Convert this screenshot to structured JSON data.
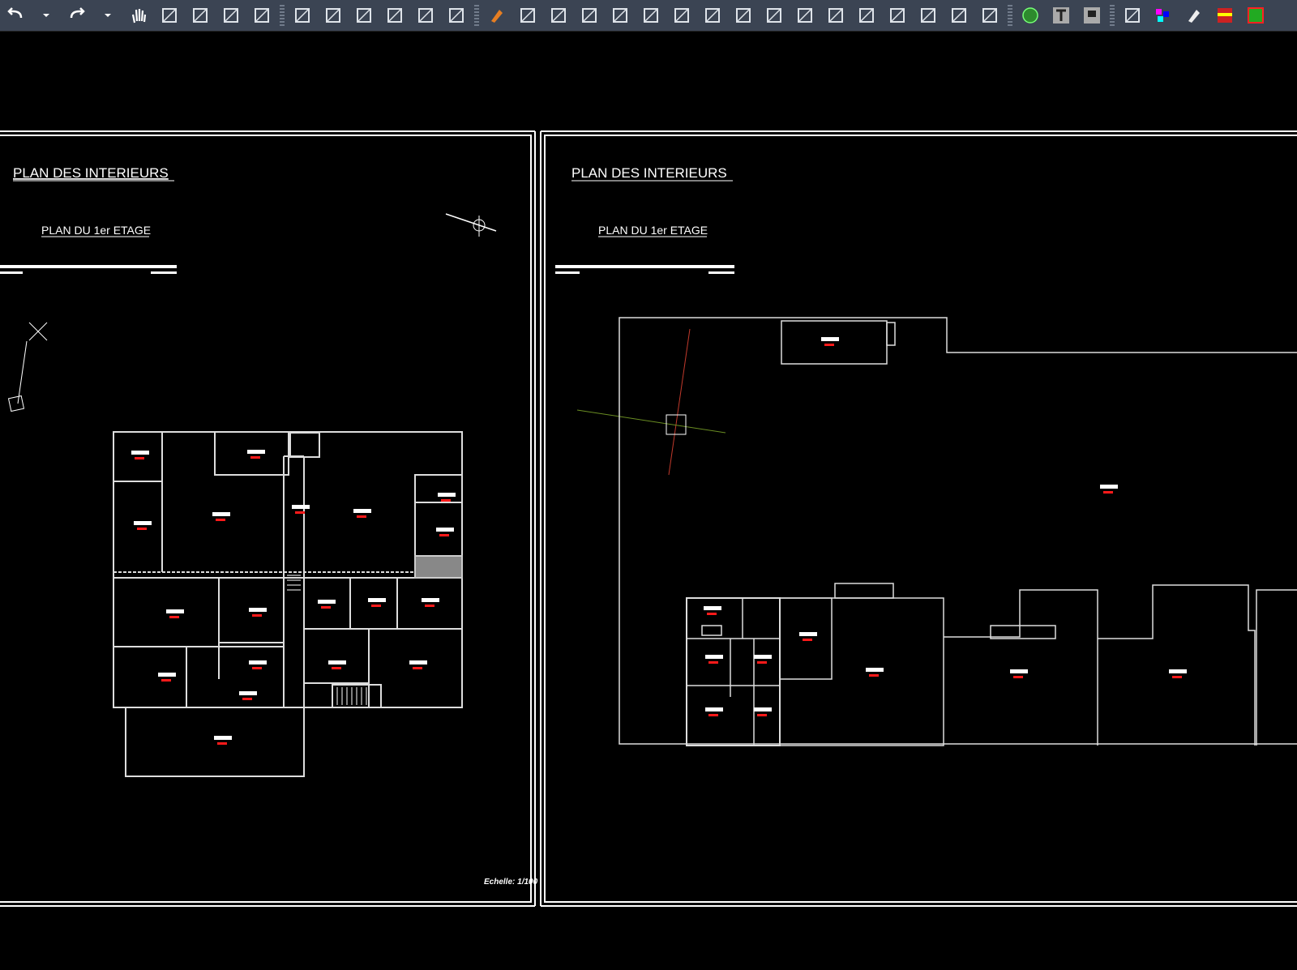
{
  "toolbar": {
    "groups": [
      [
        "undo-icon",
        "undo-dropdown-icon",
        "redo-icon",
        "redo-dropdown-icon",
        "pan-hand-icon",
        "zoom-realtime-icon",
        "zoom-window-icon",
        "zoom-extents-icon",
        "zoom-previous-icon"
      ],
      [
        "properties-icon",
        "design-center-icon",
        "tool-palettes-icon",
        "sheet-set-icon",
        "markup-icon",
        "quickcalc-icon"
      ],
      [
        "erase-icon",
        "copy-icon",
        "mirror-icon",
        "offset-icon",
        "move-icon",
        "rotate-icon",
        "scale-icon",
        "stretch-icon",
        "trim-icon",
        "extend-icon",
        "break-icon",
        "break-at-point-icon",
        "join-icon",
        "chamfer-icon",
        "fillet-icon",
        "spline-icon",
        "solid-3d-icon"
      ],
      [
        "hatch-icon",
        "text-icon",
        "block-icon"
      ],
      [
        "layer-off-icon",
        "color-palette-icon",
        "pen-icon",
        "layer-props-icon",
        "layout-icon"
      ]
    ]
  },
  "viewports": {
    "left": {
      "title": "PLAN  DES INTERIEURS",
      "subtitle": "PLAN DU 1er ETAGE",
      "scale_note": "Echelle: 1/100"
    },
    "right": {
      "title": "PLAN  DES INTERIEURS",
      "subtitle": "PLAN DU 1er ETAGE"
    }
  },
  "colors": {
    "toolbar_bg": "#3b4453",
    "canvas_bg": "#000000",
    "lines": "#ffffff",
    "markers": "#ff1a1a",
    "doors": "#2ecc40",
    "windows": "#14b8b8",
    "axis_red": "#c0392b",
    "axis_green": "#6b8e23"
  }
}
